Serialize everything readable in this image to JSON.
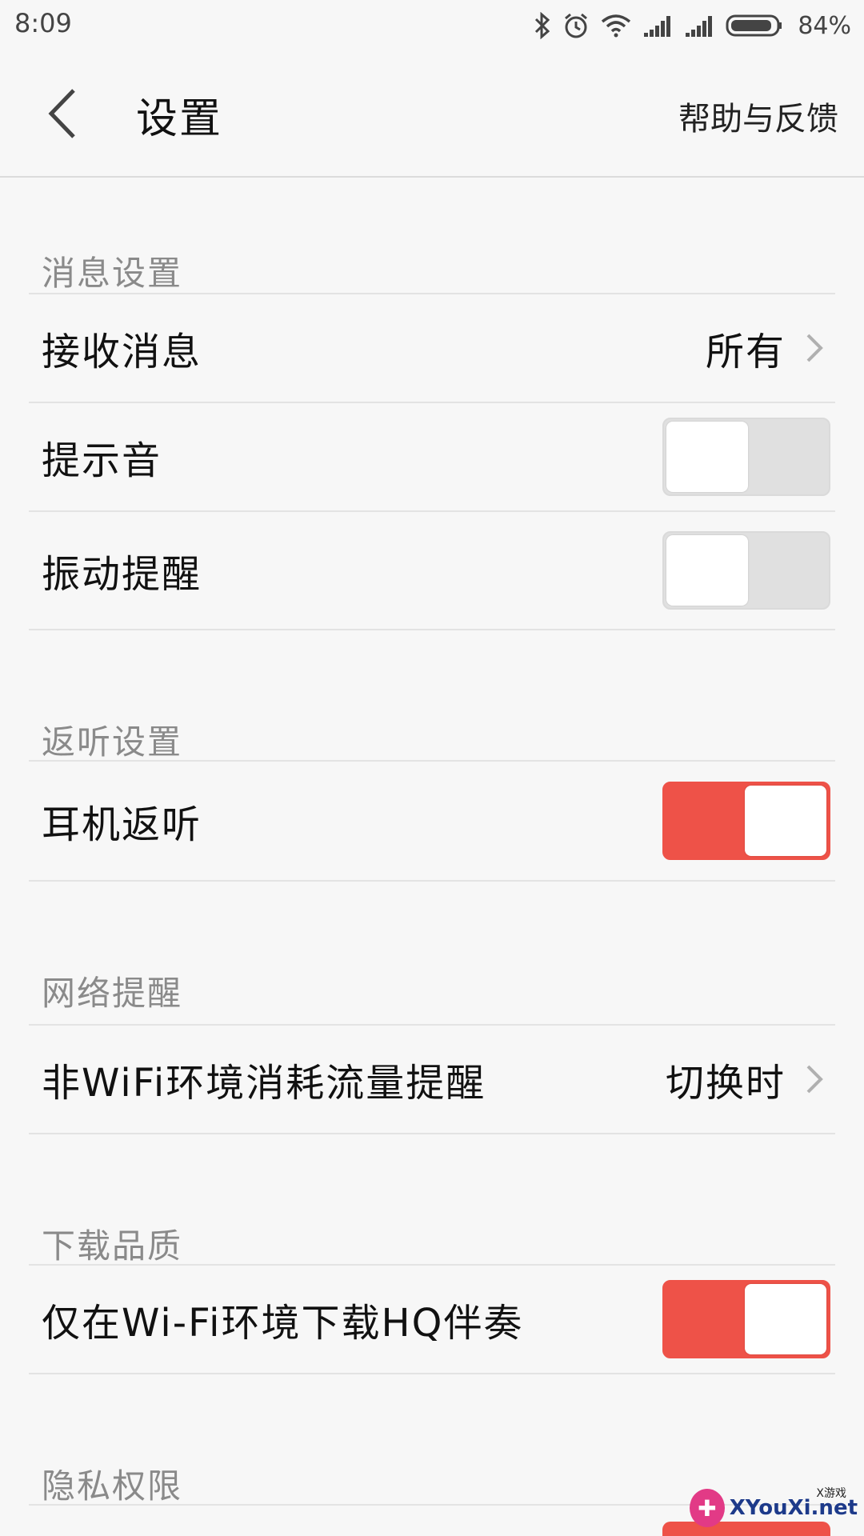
{
  "status_bar": {
    "time": "8:09",
    "battery_percent": "84%",
    "icons": [
      "bluetooth-icon",
      "alarm-icon",
      "wifi-icon",
      "signal-icon",
      "signal-icon",
      "battery-icon"
    ]
  },
  "header": {
    "title": "设置",
    "help_label": "帮助与反馈",
    "back_icon": "chevron-left-icon"
  },
  "sections": {
    "messages": {
      "title": "消息设置",
      "receive_label": "接收消息",
      "receive_value": "所有",
      "sound_label": "提示音",
      "sound_on": false,
      "vibrate_label": "振动提醒",
      "vibrate_on": false
    },
    "monitor": {
      "title": "返听设置",
      "earphone_label": "耳机返听",
      "earphone_on": true
    },
    "network": {
      "title": "网络提醒",
      "data_label": "非WiFi环境消耗流量提醒",
      "data_value": "切换时"
    },
    "download": {
      "title": "下载品质",
      "hq_label": "仅在Wi-Fi环境下载HQ伴奏",
      "hq_on": true
    },
    "privacy": {
      "title": "隐私权限",
      "partial_toggle_on": true
    }
  },
  "watermark": {
    "text": "XYouXi.net",
    "small": "X游戏"
  },
  "colors": {
    "accent": "#ee5248",
    "toggle_off": "#e0e0e0",
    "section_text": "#8a8a8a",
    "background": "#f7f7f7"
  }
}
